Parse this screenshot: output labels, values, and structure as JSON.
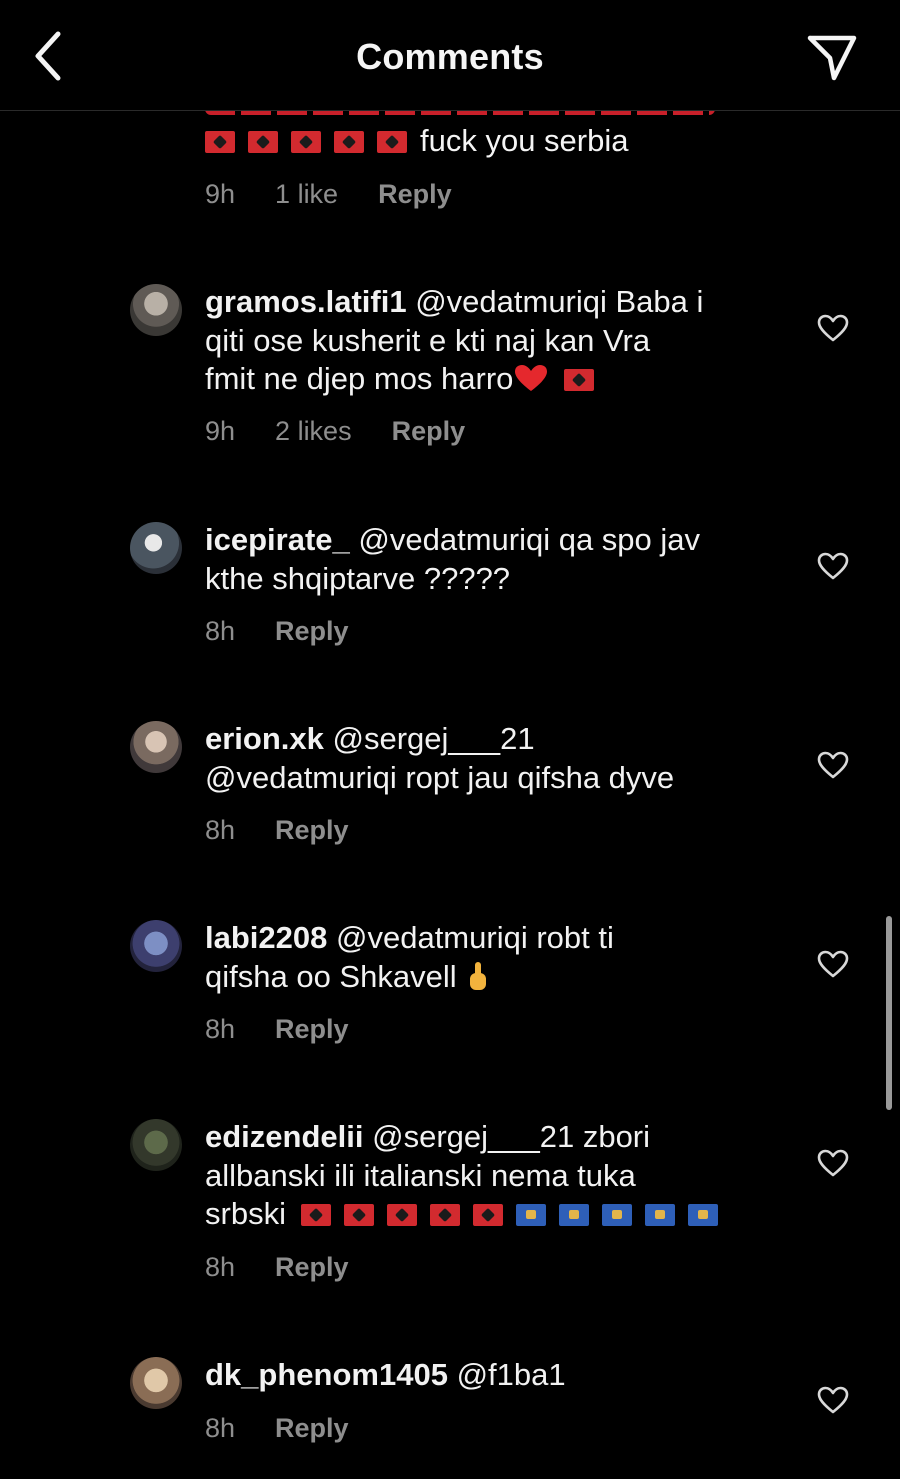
{
  "header": {
    "title": "Comments"
  },
  "top_comment": {
    "text": "fuck  you serbia",
    "time": "9h",
    "likes": "1 like",
    "reply": "Reply"
  },
  "comments": [
    {
      "username": "gramos.latifi1",
      "line1": "@vedatmuriqi Baba i",
      "line2": "qiti ose kusherit e kti naj kan Vra",
      "line3": "fmit ne djep mos harro",
      "time": "9h",
      "likes": "2 likes",
      "reply": "Reply"
    },
    {
      "username": "icepirate_",
      "line1": "@vedatmuriqi qa spo jav",
      "line2": "kthe shqiptarve ?????",
      "time": "8h",
      "reply": "Reply"
    },
    {
      "username": "erion.xk",
      "line1": "@sergej___21",
      "line2": "@vedatmuriqi  ropt jau qifsha dyve",
      "time": "8h",
      "reply": "Reply"
    },
    {
      "username": "labi2208",
      "line1": "@vedatmuriqi robt ti",
      "line2": "qifsha oo Shkavell",
      "time": "8h",
      "reply": "Reply"
    },
    {
      "username": "edizendelii",
      "line1": "@sergej___21 zbori",
      "line2": "allbanski ili italianski nema tuka",
      "line3": "srbski",
      "time": "8h",
      "reply": "Reply"
    },
    {
      "username": "dk_phenom1405",
      "line1": "@f1ba1",
      "time": "8h",
      "reply": "Reply"
    }
  ],
  "icons": [
    "back-arrow-icon",
    "send-icon",
    "heart-outline-icon",
    "albania-flag-icon",
    "kosovo-flag-icon",
    "red-heart-icon",
    "middle-finger-icon"
  ],
  "colors": {
    "background": "#000000",
    "text": "#f2f2f2",
    "meta": "#8e8e8e",
    "albania_red": "#d22a2f",
    "kosovo_blue": "#2e5fb8"
  }
}
